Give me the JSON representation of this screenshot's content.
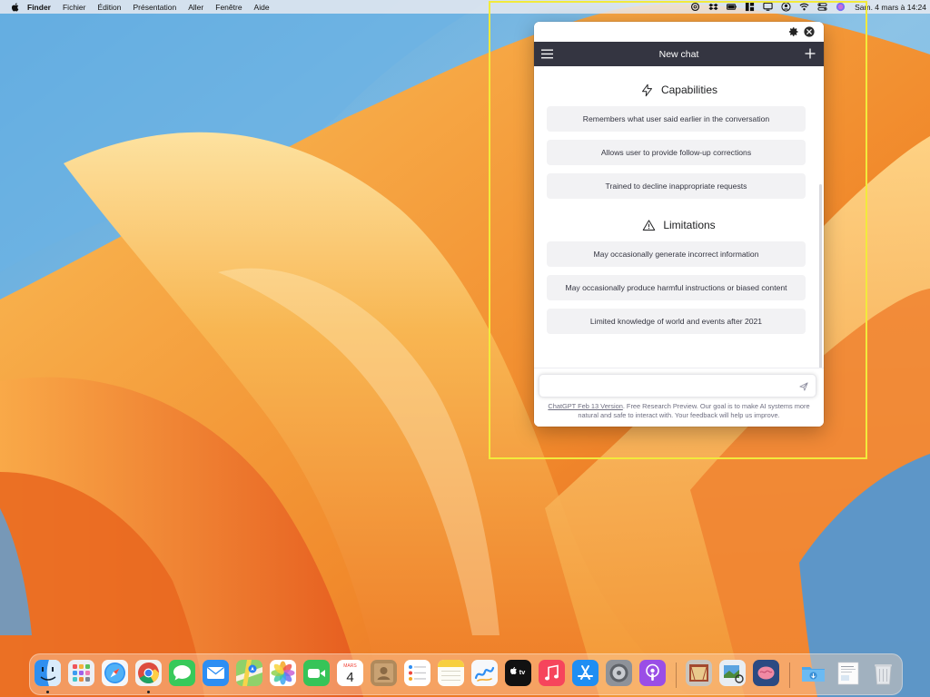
{
  "menubar": {
    "items": [
      "Finder",
      "Fichier",
      "Édition",
      "Présentation",
      "Aller",
      "Fenêtre",
      "Aide"
    ],
    "status_icons": [
      "openai-icon",
      "dropbox-icon",
      "battery-icon",
      "grid-icon",
      "display-icon",
      "user-account-icon",
      "wifi-icon",
      "control-center-icon",
      "siri-icon"
    ],
    "clock": "Sam. 4 mars à 14:24"
  },
  "chat_window": {
    "title": "New chat",
    "capabilities": {
      "heading": "Capabilities",
      "items": [
        "Remembers what user said earlier in the conversation",
        "Allows user to provide follow-up corrections",
        "Trained to decline inappropriate requests"
      ]
    },
    "limitations": {
      "heading": "Limitations",
      "items": [
        "May occasionally generate incorrect information",
        "May occasionally produce harmful instructions or biased content",
        "Limited knowledge of world and events after 2021"
      ]
    },
    "input": {
      "value": "",
      "placeholder": ""
    },
    "footer": {
      "link": "ChatGPT Feb 13 Version",
      "text": ". Free Research Preview. Our goal is to make AI systems more natural and safe to interact with. Your feedback will help us improve."
    }
  },
  "dock": {
    "calendar": {
      "month": "MARS",
      "day": "4"
    },
    "apps": [
      "Finder",
      "Launchpad",
      "Safari",
      "Chrome",
      "Messages",
      "Mail",
      "Plans",
      "Photos",
      "FaceTime",
      "Calendrier",
      "Contacts",
      "Rappels",
      "Notes",
      "Freeform",
      "TV",
      "Musique",
      "App Store",
      "Réglages Système",
      "Podcasts",
      "Photo Booth",
      "Aperçu",
      "ChatGPT",
      "Téléchargements",
      "Document",
      "Corbeille"
    ]
  },
  "colors": {
    "chat_header_bg": "#343541",
    "card_bg": "#f2f2f4",
    "highlight_border": "#f2ea3c"
  }
}
